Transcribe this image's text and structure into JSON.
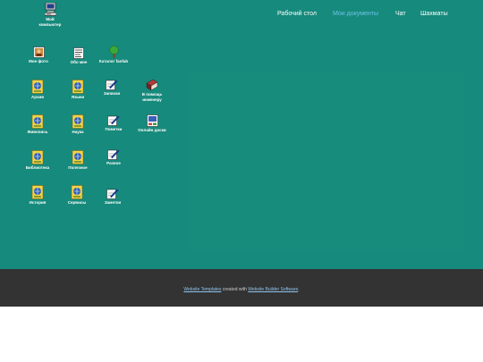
{
  "nav": [
    {
      "label": "Рабочий стол",
      "active": false
    },
    {
      "label": "Мои документы",
      "active": true
    },
    {
      "label": "Чат",
      "active": false
    },
    {
      "label": "Шахматы",
      "active": false
    }
  ],
  "icons": {
    "my_computer": {
      "label": "Мой компьютер",
      "icon": "computer-icon"
    },
    "my_photo": {
      "label": "Мое фото",
      "icon": "photo-icon"
    },
    "about_me": {
      "label": "Обо мне",
      "icon": "document-icon"
    },
    "catalog": {
      "label": "Каталог fanfab",
      "icon": "tree-icon"
    },
    "archive": {
      "label": "Архив",
      "icon": "folder-globe-icon"
    },
    "languages": {
      "label": "Языки",
      "icon": "folder-globe-icon"
    },
    "notes_1": {
      "label": "Записки",
      "icon": "note-pencil-icon"
    },
    "engineer_help": {
      "label": "В помощь инженеру",
      "icon": "book-icon"
    },
    "painting": {
      "label": "Живопись",
      "icon": "folder-globe-icon"
    },
    "science": {
      "label": "Наука",
      "icon": "folder-globe-icon"
    },
    "marks": {
      "label": "Пометки",
      "icon": "note-pencil-icon"
    },
    "online_boards": {
      "label": "Онлайн доски",
      "icon": "board-icon"
    },
    "library": {
      "label": "Библиотека",
      "icon": "folder-globe-icon"
    },
    "useful": {
      "label": "Полезное",
      "icon": "folder-globe-icon"
    },
    "misc": {
      "label": "Разное",
      "icon": "note-pencil-icon"
    },
    "history": {
      "label": "История",
      "icon": "folder-globe-icon"
    },
    "services": {
      "label": "Сервисы",
      "icon": "folder-globe-icon"
    },
    "notes_2": {
      "label": "Заметки",
      "icon": "note-pencil-icon"
    }
  },
  "footer": {
    "link1": "Website Templates",
    "mid": " created with ",
    "link2": "Website Builder Software",
    "end": "."
  },
  "colors": {
    "desktop": "#168a7c",
    "footer": "#333333",
    "active_nav": "#6ec3e8"
  }
}
